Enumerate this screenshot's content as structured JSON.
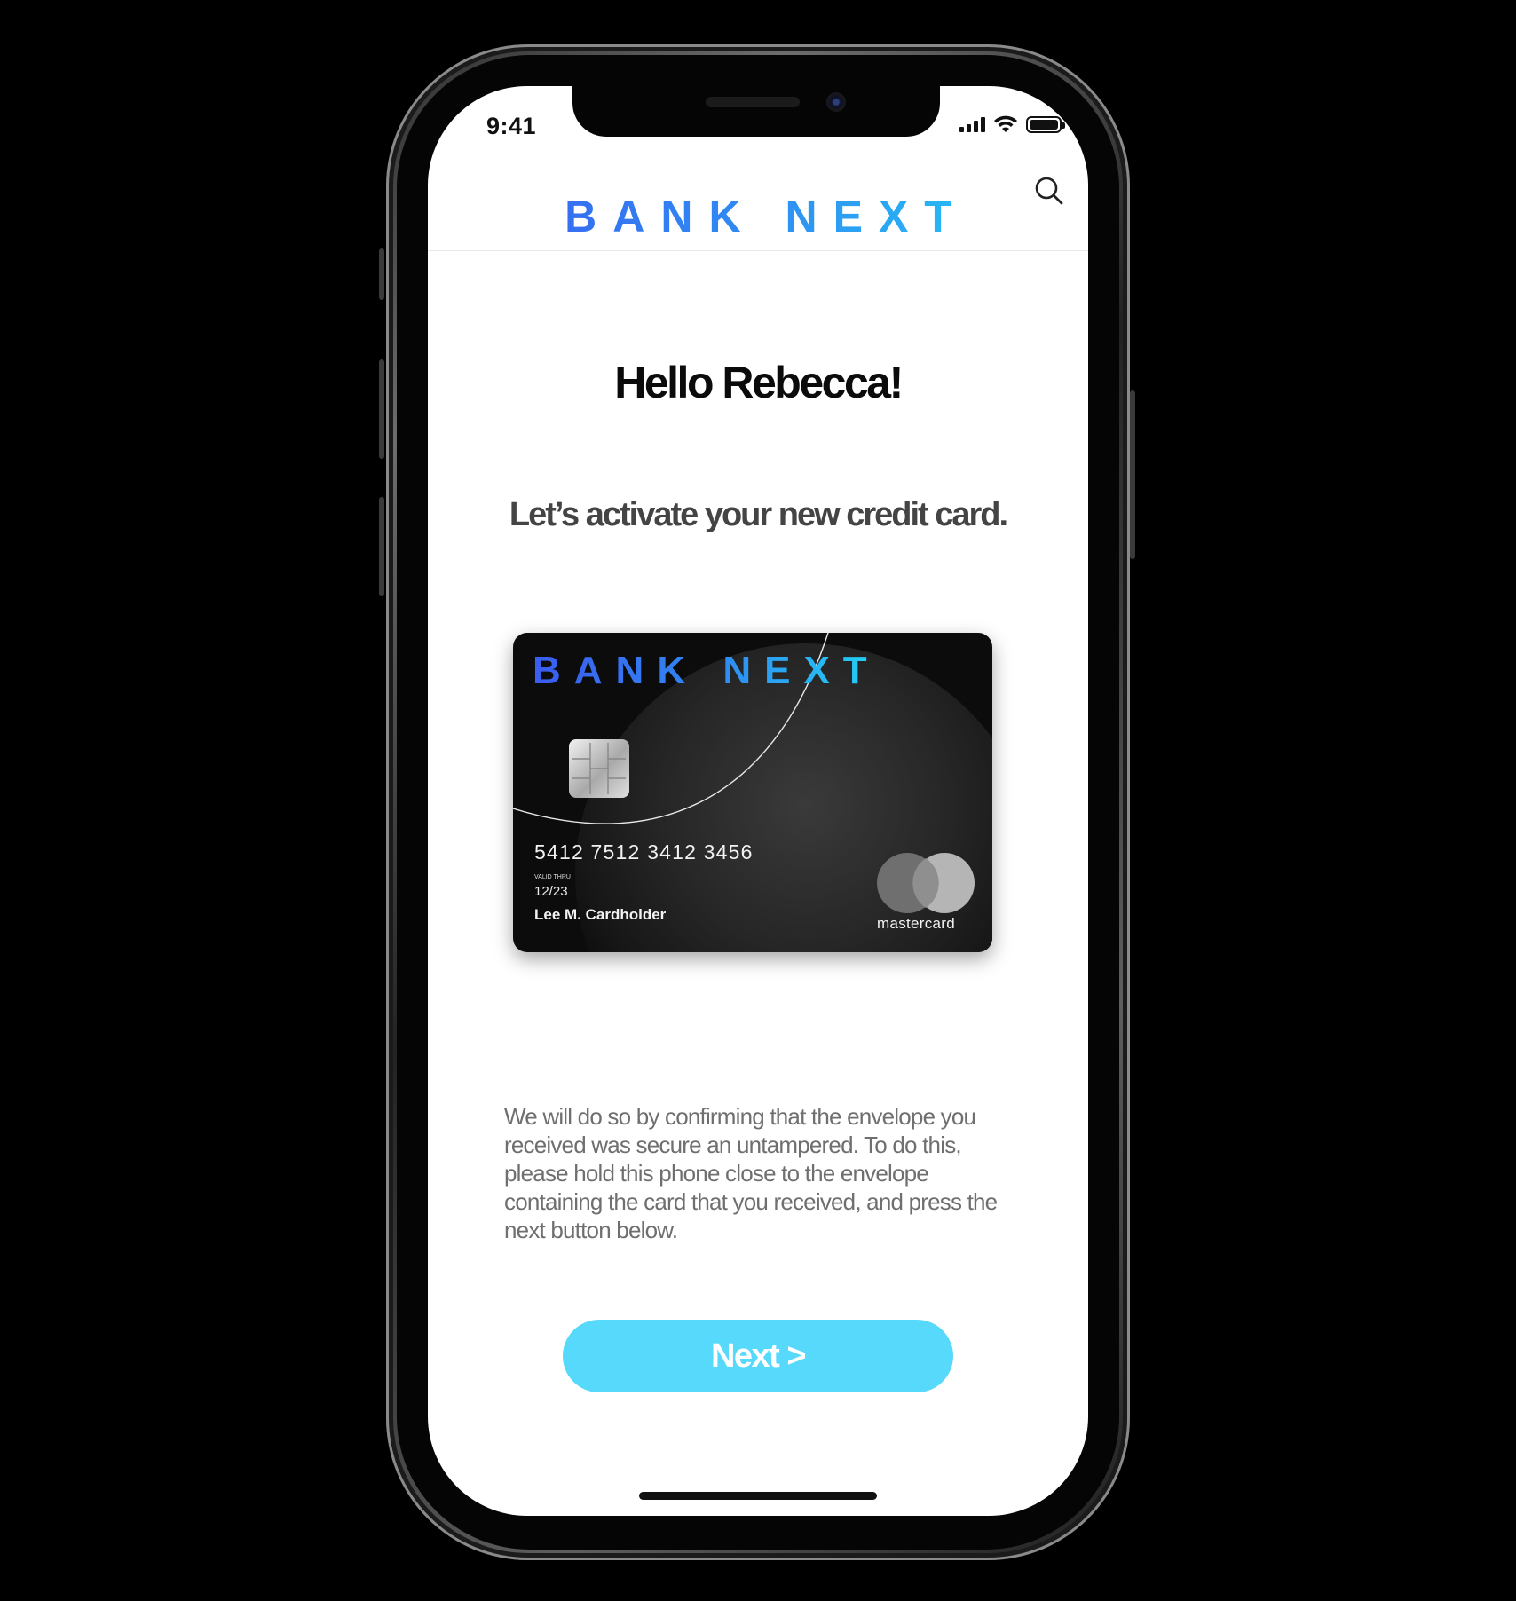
{
  "status_bar": {
    "time": "9:41",
    "battery_level": 1.0,
    "signal_bars": 4
  },
  "header": {
    "brand": "BANK NEXT",
    "search_icon": "search-icon"
  },
  "main": {
    "greeting": "Hello Rebecca!",
    "subtitle": "Let’s activate your new credit card.",
    "description": "We will do so by confirming that the envelope you received was secure an untampered. To do this, please hold this phone close to the envelope containing the card that you received, and press the next button below."
  },
  "card": {
    "brand": "BANK NEXT",
    "number": "5412 7512 3412 3456",
    "valid_thru_label": "VALID THRU",
    "expiry": "12/23",
    "holder": "Lee M. Cardholder",
    "network": "mastercard"
  },
  "actions": {
    "next_label": "Next >"
  },
  "colors": {
    "brand_gradient_start": "#3b5cf0",
    "brand_gradient_end": "#23d3f5",
    "button": "#56d9fb",
    "card_background": "#0c0c0c"
  }
}
